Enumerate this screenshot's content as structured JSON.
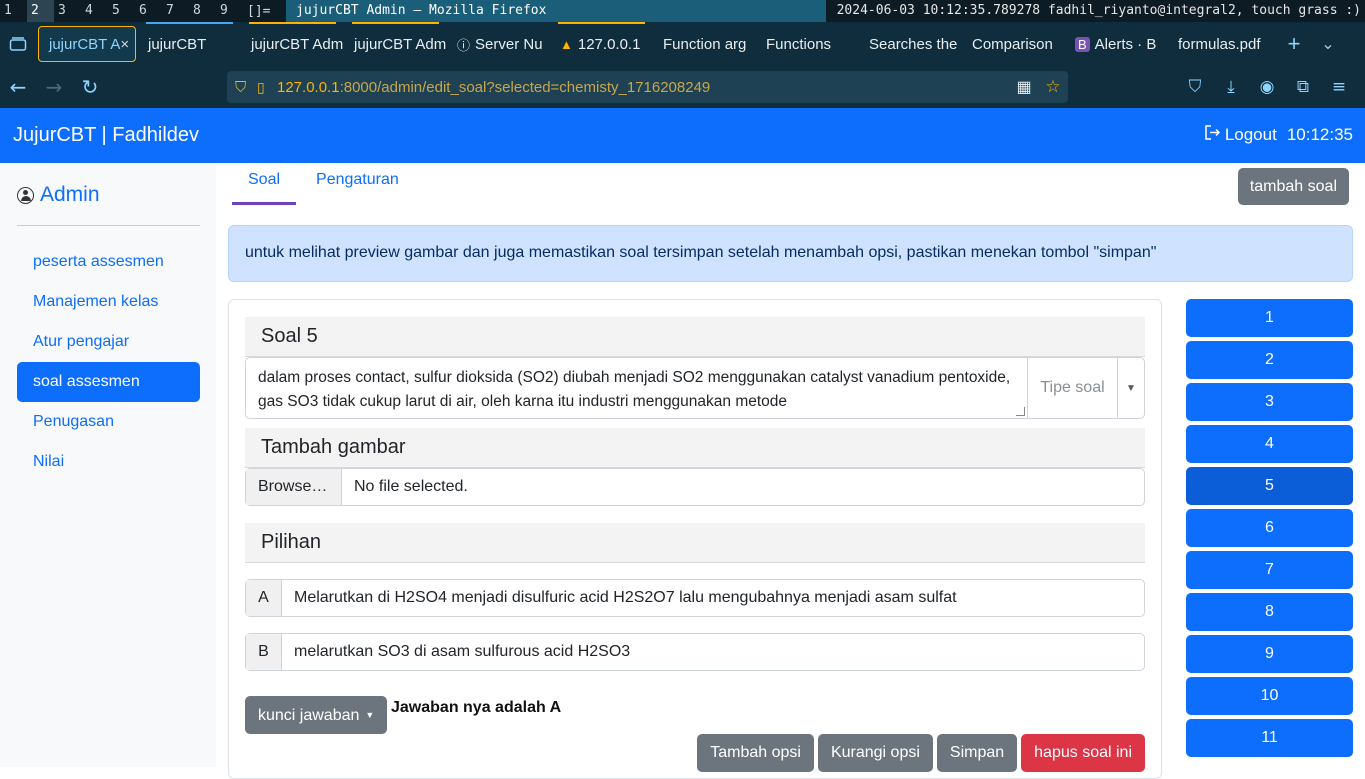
{
  "system": {
    "workspaces": [
      "1",
      "2",
      "3",
      "4",
      "5",
      "6",
      "7",
      "8",
      "9"
    ],
    "workspace_sup": [
      "",
      "",
      "",
      "",
      "",
      "",
      "",
      "",
      ""
    ],
    "layout_indicator": "[]=",
    "window_title": "jujurCBT Admin — Mozilla Firefox",
    "status": "2024-06-03 10:12:35.789278 fadhil_riyanto@integral2, touch grass :)"
  },
  "browser": {
    "tabs": [
      {
        "label": "jujurCBT A",
        "close": "×"
      },
      {
        "label": "jujurCBT"
      },
      {
        "label": "jujurCBT Adm"
      },
      {
        "label": "jujurCBT Adm"
      },
      {
        "label": "Server Nu"
      },
      {
        "label": "127.0.0.1"
      },
      {
        "label": "Function arg"
      },
      {
        "label": "Functions"
      },
      {
        "label": "Searches the"
      },
      {
        "label": "Comparison"
      },
      {
        "label": "Alerts · B"
      },
      {
        "label": "formulas.pdf"
      }
    ],
    "url_host": "127.0.0.1",
    "url_rest": ":8000/admin/edit_soal?selected=chemisty_1716208249"
  },
  "app": {
    "brand": "JujurCBT | Fadhildev",
    "logout_label": "Logout",
    "clock": "10:12:35"
  },
  "sidebar": {
    "title": "Admin",
    "items": [
      {
        "label": "peserta assesmen"
      },
      {
        "label": "Manajemen kelas"
      },
      {
        "label": "Atur pengajar"
      },
      {
        "label": "soal assesmen"
      },
      {
        "label": "Penugasan"
      },
      {
        "label": "Nilai"
      }
    ]
  },
  "main": {
    "tabs": [
      {
        "label": "Soal"
      },
      {
        "label": "Pengaturan"
      }
    ],
    "add_button": "tambah soal",
    "alert": "untuk melihat preview gambar dan juga memastikan soal tersimpan setelah menambah opsi, pastikan menekan tombol \"simpan\"",
    "question_heading": "Soal 5",
    "question_text": "dalam proses contact, sulfur dioksida (SO2) diubah menjadi SO2 menggunakan catalyst vanadium pentoxide, gas SO3 tidak cukup larut di air, oleh karna itu industri menggunakan metode",
    "type_placeholder": "Tipe soal",
    "image_heading": "Tambah gambar",
    "browse_label": "Browse…",
    "file_status": "No file selected.",
    "options_heading": "Pilihan",
    "options": [
      {
        "letter": "A",
        "text": "Melarutkan di H2SO4 menjadi disulfuric acid H2S2O7 lalu mengubahnya menjadi asam sulfat"
      },
      {
        "letter": "B",
        "text": "melarutkan SO3 di asam sulfurous acid H2SO3"
      }
    ],
    "key_button": "kunci jawaban",
    "answer_text": "Jawaban nya adalah A",
    "actions": {
      "add_option": "Tambah opsi",
      "remove_option": "Kurangi opsi",
      "save": "Simpan",
      "delete": "hapus soal ini"
    },
    "question_numbers": [
      "1",
      "2",
      "3",
      "4",
      "5",
      "6",
      "7",
      "8",
      "9",
      "10",
      "11"
    ]
  },
  "colors": {
    "primary": "#0d6efd",
    "secondary": "#6c757d",
    "danger": "#dc3545",
    "alert_bg": "#cfe2ff",
    "browser_chrome": "#0f2d3c"
  }
}
